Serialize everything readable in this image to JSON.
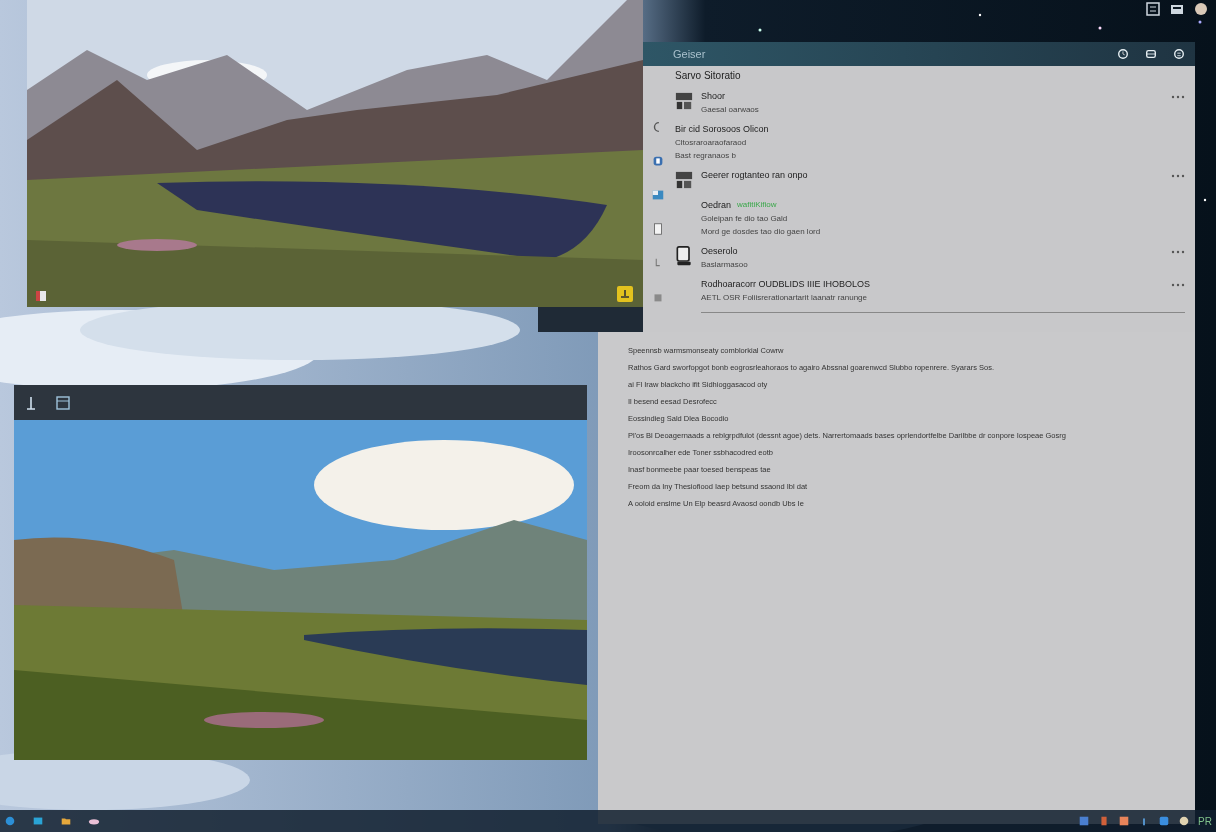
{
  "panel": {
    "title": "Geiser",
    "heading": "Sarvo Sitoratio",
    "items": [
      {
        "kind": "thumb",
        "title": "Shoor",
        "lines": [
          "Gaesal oarwaos"
        ]
      },
      {
        "kind": "wide",
        "title": "Bir cid  Sorosoos Olicon",
        "lines": [
          "Cltosraroaraofaraod",
          "Bast regranaos b"
        ]
      },
      {
        "kind": "thumb",
        "title": "Geerer rogtanteo ran onpo"
      },
      {
        "kind": "plain",
        "title": "Oedran",
        "tag": "wafitiKifiow",
        "lines": [
          "Goleipan  fe dio tao Gald",
          "Mord ge dosdes tao dio gaen lord"
        ]
      },
      {
        "kind": "device",
        "title": "Oeserolo",
        "lines": [
          "Baslarmasoo"
        ]
      },
      {
        "kind": "plain",
        "title": "Rodhoaracorr OUDBLIDS IIIE IHOBOLOS",
        "lines": [
          "AETL OSR Foliisrerationartarit laanatr ranunge"
        ]
      }
    ],
    "notes": [
      "Speennsb warmsmonseaty comblorkial Cowrw",
      "Rathos Gard sworfopgot bonb eogrosrleahoraos to agairo Abssnal goarenwcd Slubbo ropenrere. Syarars Sos.",
      "ai Fl Iraw blackcho ifit Sidhioggasacod oty",
      "Il besend eesad  Desrofecc",
      "Eossindieg Sald Dlea Bocodio",
      "Pl'os Bl Deoagernaads a reblgrpdfulot (dessnt agoe) dets. Narrertomaads bases oprlendortfelbe Darilbbe dr conpore Iospeae Gosrg",
      "Iroosonrcalher ede Toner ssbhacodred eotb",
      "Inasf bonmeebe paar toesed benspeas tae",
      "Freom da Iny Thesiofiood Iaep betsund ssaond Ibl dat",
      "A ooloid enslme Un Elp beasrd Avaosd oondb Ubs Ie"
    ]
  },
  "taskbar": {
    "tray_text": "PR"
  }
}
